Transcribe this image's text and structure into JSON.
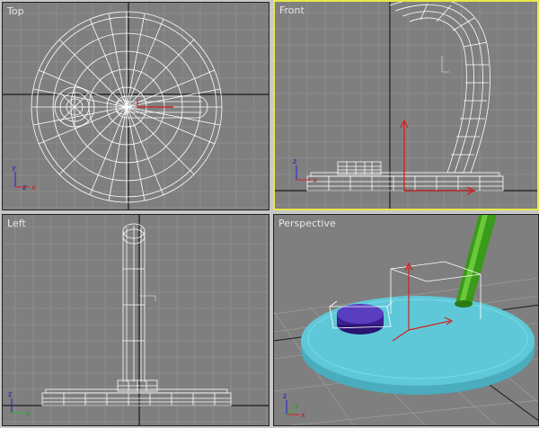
{
  "viewports": {
    "top": {
      "label": "Top"
    },
    "front": {
      "label": "Front"
    },
    "left": {
      "label": "Left"
    },
    "perspective": {
      "label": "Perspective"
    }
  },
  "active_viewport": "front",
  "colors": {
    "viewport_bg": "#7f7f7f",
    "grid": "#8e8e8e",
    "axis_line": "#1a1a1a",
    "wireframe": "#ffffff",
    "active_border": "#e8e84a",
    "base_shade": "#5fc8d8",
    "button_shade": "#4a2aa8",
    "stem_shade": "#3a9a1a",
    "gizmo_x": "#d42020",
    "gizmo_y": "#20c020",
    "gizmo_z": "#2020d4"
  },
  "axis_triad": {
    "x": "x",
    "y": "y",
    "z": "z"
  }
}
